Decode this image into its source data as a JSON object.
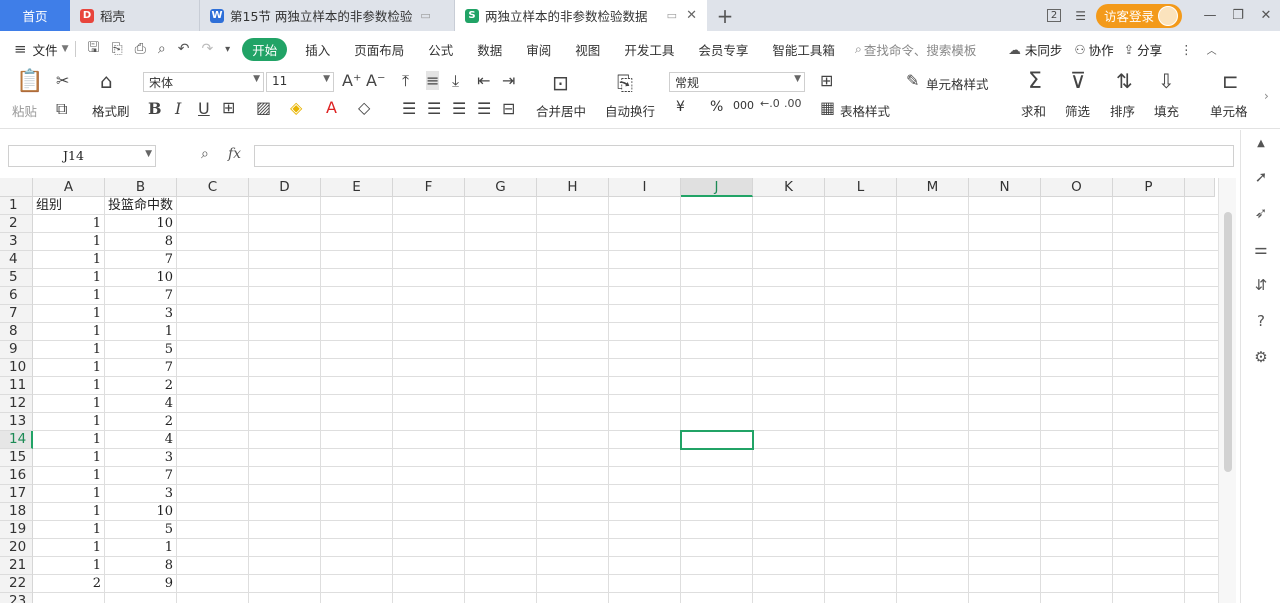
{
  "tabs": {
    "home": "首页",
    "daoke": "稻壳",
    "doc": "第15节 两独立样本的非参数检验",
    "sheet": "两独立样本的非参数检验数据",
    "window_count": "2",
    "login": "访客登录"
  },
  "menu": {
    "file": "文件",
    "items": [
      "开始",
      "插入",
      "页面布局",
      "公式",
      "数据",
      "审阅",
      "视图",
      "开发工具",
      "会员专享",
      "智能工具箱"
    ],
    "search_placeholder": "查找命令、搜索模板",
    "sync": "未同步",
    "collab": "协作",
    "share": "分享"
  },
  "ribbon": {
    "paste": "粘贴",
    "format_painter": "格式刷",
    "font_name": "宋体",
    "font_size": "11",
    "merge_center": "合并居中",
    "wrap": "自动换行",
    "number_format": "常规",
    "cell_style": "单元格样式",
    "table_style": "表格样式",
    "sum": "求和",
    "filter": "筛选",
    "sort": "排序",
    "fill": "填充",
    "cell": "单元格",
    "currency": "¥",
    "percent": "%",
    "thousands": "000"
  },
  "formula_bar": {
    "name_box": "J14",
    "fx": "fx",
    "value": ""
  },
  "sheet": {
    "columns": [
      "A",
      "B",
      "C",
      "D",
      "E",
      "F",
      "G",
      "H",
      "I",
      "J",
      "K",
      "L",
      "M",
      "N",
      "O",
      "P"
    ],
    "selected_column": "J",
    "selected_row": "14",
    "header_row": [
      "组别",
      "投篮命中数"
    ],
    "rows": [
      [
        "1",
        "10"
      ],
      [
        "1",
        "8"
      ],
      [
        "1",
        "7"
      ],
      [
        "1",
        "10"
      ],
      [
        "1",
        "7"
      ],
      [
        "1",
        "3"
      ],
      [
        "1",
        "1"
      ],
      [
        "1",
        "5"
      ],
      [
        "1",
        "7"
      ],
      [
        "1",
        "2"
      ],
      [
        "1",
        "4"
      ],
      [
        "1",
        "2"
      ],
      [
        "1",
        "4"
      ],
      [
        "1",
        "3"
      ],
      [
        "1",
        "7"
      ],
      [
        "1",
        "3"
      ],
      [
        "1",
        "10"
      ],
      [
        "1",
        "5"
      ],
      [
        "1",
        "1"
      ],
      [
        "1",
        "8"
      ],
      [
        "2",
        "9"
      ]
    ]
  },
  "colors": {
    "accent_green": "#21a366",
    "home_tab_blue": "#3f7ee8",
    "login_orange": "#f39a1a"
  }
}
